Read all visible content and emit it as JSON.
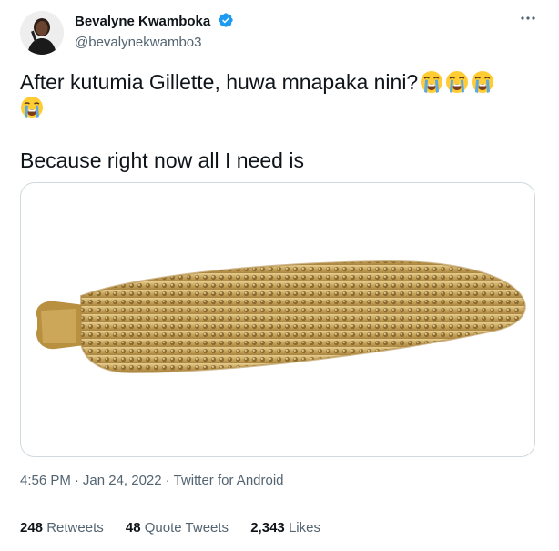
{
  "author": {
    "display_name": "Bevalyne Kwamboka",
    "handle": "@bevalynekwambo3",
    "verified": true
  },
  "tweet": {
    "line1": "After kutumia Gillette, huwa mnapaka nini?",
    "line1_emoji": [
      "loudly-crying-face",
      "loudly-crying-face",
      "loudly-crying-face",
      "loudly-crying-face"
    ],
    "line2": "Because right now all I need is",
    "time": "4:56 PM",
    "date": "Jan 24, 2022",
    "source": "Twitter for Android",
    "separator": "·"
  },
  "stats": {
    "retweets_count": "248",
    "retweets_label": "Retweets",
    "quotes_count": "48",
    "quotes_label": "Quote Tweets",
    "likes_count": "2,343",
    "likes_label": "Likes"
  },
  "icons": {
    "verified": "verified-badge-icon",
    "more": "more-options-icon"
  },
  "colors": {
    "verified_blue": "#1d9bf0",
    "secondary_text": "#536471",
    "primary_text": "#0f1419",
    "border": "#cfd9de"
  }
}
